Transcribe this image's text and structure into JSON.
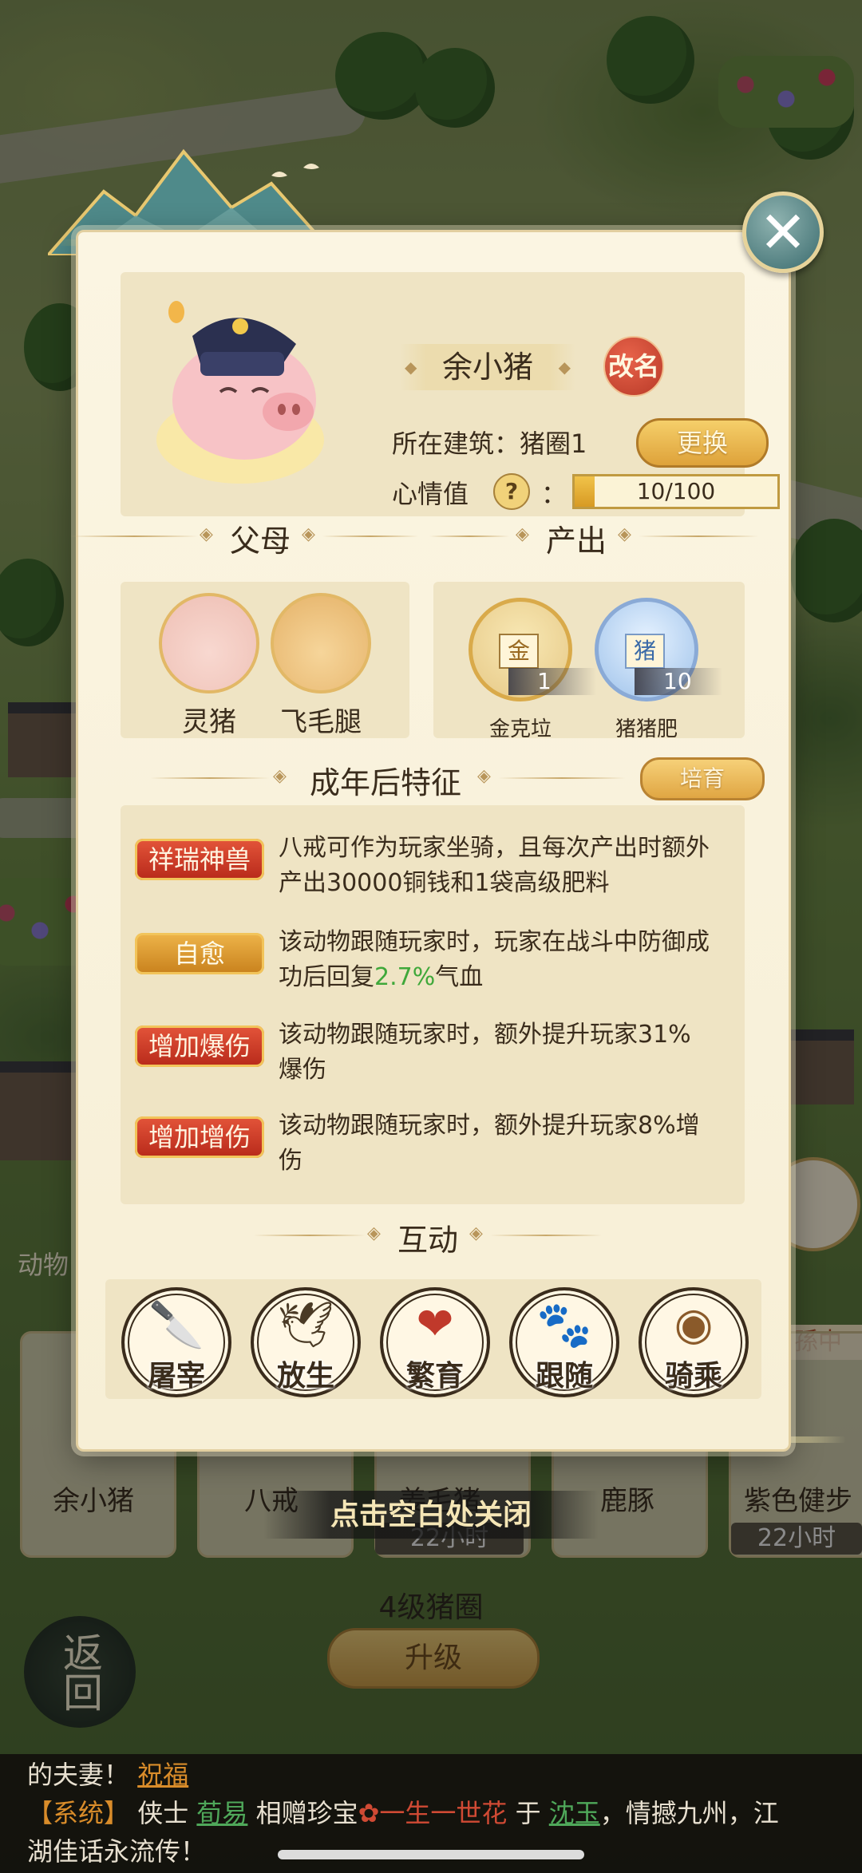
{
  "colors": {
    "accent_gold": "#e0a643",
    "tag_red": "#c7361f",
    "green_highlight": "#3fa83a"
  },
  "modal": {
    "pet": {
      "name": "余小猪",
      "rename_label": "改名",
      "building_label": "所在建筑：猪圈1",
      "change_label": "更换",
      "mood_label": "心情值",
      "mood_colon": "：",
      "mood_current": 10,
      "mood_max": 100,
      "mood_text": "10/100"
    },
    "parents": {
      "title": "父母",
      "items": [
        {
          "name": "灵猪"
        },
        {
          "name": "飞毛腿"
        }
      ]
    },
    "output": {
      "title": "产出",
      "items": [
        {
          "icon_char": "金",
          "count": "1",
          "name": "金克垃"
        },
        {
          "icon_char": "猪",
          "count": "10",
          "name": "猪猪肥"
        }
      ]
    },
    "traits": {
      "title": "成年后特征",
      "nurture_label": "培育",
      "items": [
        {
          "tag": "祥瑞神兽",
          "line1": "八戒可作为玩家坐骑，且每次产出时额外",
          "line2": "产出30000铜钱和1袋高级肥料"
        },
        {
          "tag": "自愈",
          "line1": "该动物跟随玩家时，玩家在战斗中防御成",
          "line2_pre": "功后回复",
          "line2_hl": "2.7%",
          "line2_post": "气血"
        },
        {
          "tag": "增加爆伤",
          "line1": "该动物跟随玩家时，额外提升玩家31%",
          "line2": "爆伤"
        },
        {
          "tag": "增加增伤",
          "line1": "该动物跟随玩家时，额外提升玩家8%增",
          "line2": "伤"
        }
      ]
    },
    "interact": {
      "title": "互动",
      "actions": [
        {
          "label": "屠宰",
          "icon": "cleaver-icon"
        },
        {
          "label": "放生",
          "icon": "bird-icon"
        },
        {
          "label": "繁育",
          "icon": "hearts-icon"
        },
        {
          "label": "跟随",
          "icon": "paw-icon"
        },
        {
          "label": "骑乘",
          "icon": "saddle-icon"
        }
      ]
    },
    "close_hint": "点击空白处关闭"
  },
  "background": {
    "left_label": "动物",
    "right_tag": "孫中",
    "animals": [
      {
        "name": "余小猪",
        "time": ""
      },
      {
        "name": "八戒",
        "time": ""
      },
      {
        "name": "姜毛猪",
        "time": "22小时"
      },
      {
        "name": "鹿豚",
        "time": ""
      },
      {
        "name": "紫色健步",
        "time": "22小时"
      }
    ],
    "level_title": "4级猪圈",
    "upgrade_label": "升级",
    "back_label": "返回"
  },
  "chat": {
    "line1_text": "的夫妻！",
    "line1_link": "祝福",
    "sys": "【系统】",
    "l2a": "侠士",
    "l2_name1": "荀易",
    "l2b": "相赠珍宝",
    "l2_item": "一生一世花",
    "l2c": "于",
    "l2_name2": "沈玉",
    "l2d": "，情撼九州，江",
    "line3": "湖佳话永流传！"
  }
}
